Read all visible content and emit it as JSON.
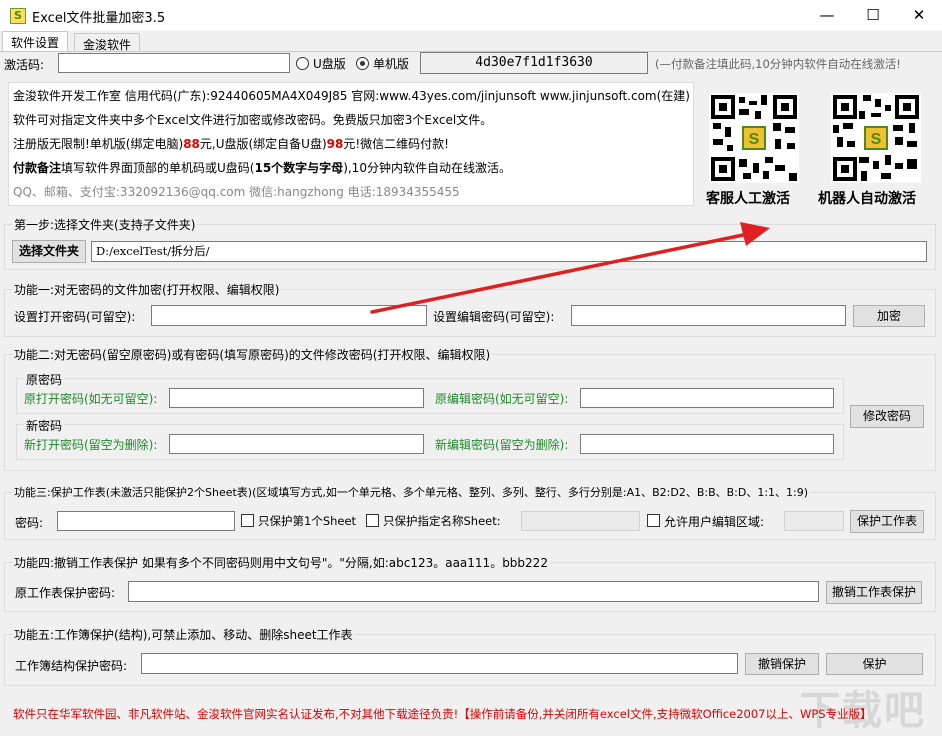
{
  "window": {
    "title": "Excel文件批量加密3.5",
    "minimize": "—",
    "maximize": "☐",
    "close": "✕"
  },
  "tabs": [
    "软件设置",
    "金浚软件"
  ],
  "activation": {
    "label": "激活码:",
    "value": "",
    "radio_usb": "U盘版",
    "radio_single": "单机版",
    "selected": "单机版",
    "machine_code": "4d30e7f1d1f3630",
    "note": "(—付款备注填此码,10分钟内软件自动在线激活!"
  },
  "info": {
    "line1": "金浚软件开发工作室 信用代码(广东):92440605MA4X049J85 官网:www.43yes.com/jinjunsoft  www.jinjunsoft.com(在建)",
    "line2": "软件可对指定文件夹中多个Excel文件进行加密或修改密码。免费版只加密3个Excel文件。",
    "line3_a": "注册版无限制!单机版(绑定电脑)",
    "line3_price1": "88",
    "line3_b": "元,U盘版(绑定自备U盘)",
    "line3_price2": "98",
    "line3_c": "元!微信二维码付款!",
    "line4_bold": "付款备注",
    "line4_a": "填写软件界面顶部的单机码或U盘码(",
    "line4_bold2": "15个数字与字母",
    "line4_b": "),10分钟内软件自动在线激活。",
    "line5": "QQ、邮箱、支付宝:332092136@qq.com  微信:hangzhong  电话:18934355455"
  },
  "qr": {
    "left_caption": "客服人工激活",
    "right_caption": "机器人自动激活"
  },
  "step1": {
    "legend": "第一步:选择文件夹(支持子文件夹)",
    "button": "选择文件夹",
    "path": "D:/excelTest/拆分后/"
  },
  "func1": {
    "legend": "功能一:对无密码的文件加密(打开权限、编辑权限)",
    "open_label": "设置打开密码(可留空):",
    "edit_label": "设置编辑密码(可留空):",
    "button": "加密"
  },
  "func2": {
    "legend": "功能二:对无密码(留空原密码)或有密码(填写原密码)的文件修改密码(打开权限、编辑权限)",
    "old_group": "原密码",
    "old_open_label": "原打开密码(如无可留空):",
    "old_edit_label": "原编辑密码(如无可留空):",
    "new_group": "新密码",
    "new_open_label": "新打开密码(留空为删除):",
    "new_edit_label": "新编辑密码(留空为删除):",
    "button": "修改密码"
  },
  "func3": {
    "legend": "功能三:保护工作表(未激活只能保护2个Sheet表)(区域填写方式,如一个单元格、多个单元格、整列、多列、整行、多行分别是:A1、B2:D2、B:B、B:D、1:1、1:9)",
    "pwd_label": "密码:",
    "check1": "只保护第1个Sheet",
    "check2": "只保护指定名称Sheet:",
    "check3": "允许用户编辑区域:",
    "button": "保护工作表"
  },
  "func4": {
    "legend": "功能四:撤销工作表保护  如果有多个不同密码则用中文句号\"。\"分隔,如:abc123。aaa111。bbb222",
    "label": "原工作表保护密码:",
    "button": "撤销工作表保护"
  },
  "func5": {
    "legend": "功能五:工作簿保护(结构),可禁止添加、移动、删除sheet工作表",
    "label": "工作簿结构保护密码:",
    "btn_cancel": "撤销保护",
    "btn_protect": "保护"
  },
  "footer": "软件只在华军软件园、非凡软件站、金浚软件官网实名认证发布,不对其他下载途径负责!【操作前请备份,并关闭所有excel文件,支持微软Office2007以上、WPS专业版】",
  "watermark": "下载吧"
}
